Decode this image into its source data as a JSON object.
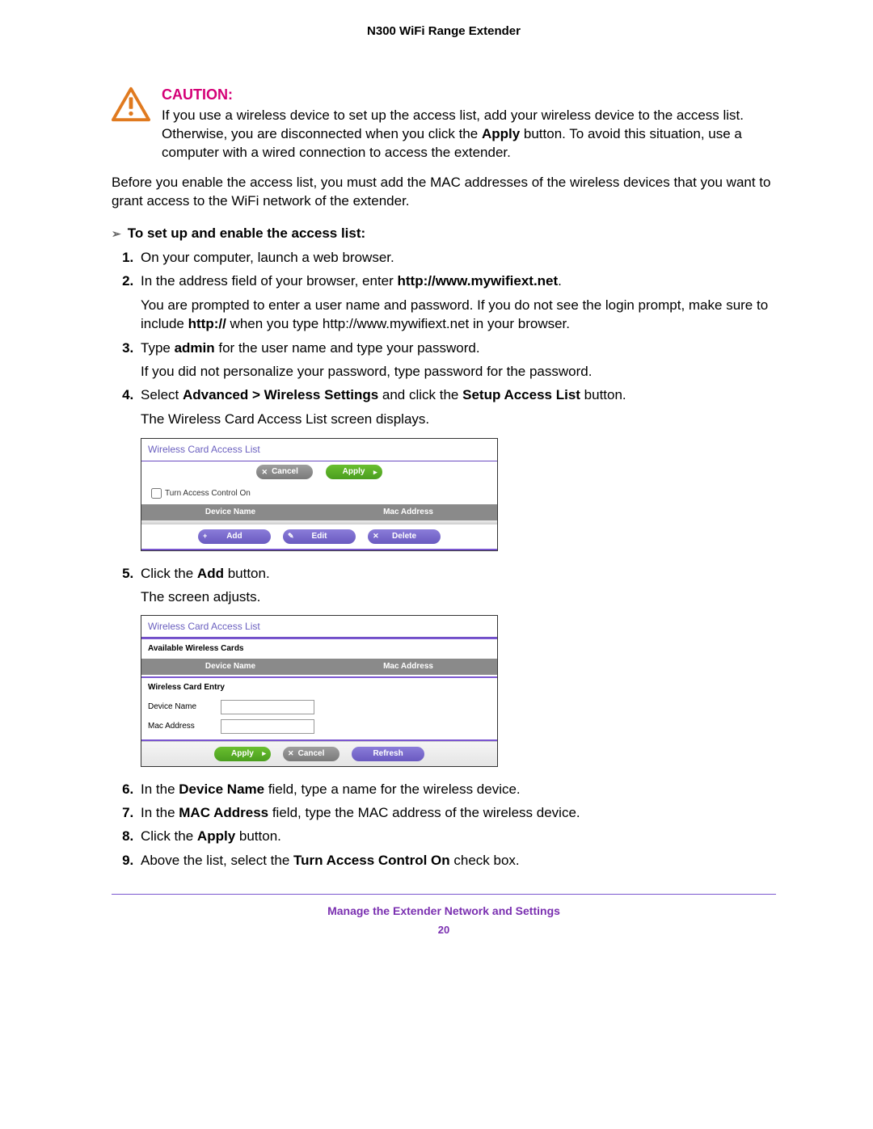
{
  "header": {
    "title": "N300 WiFi Range Extender"
  },
  "caution": {
    "label": "CAUTION:",
    "text_before_bold": "If you use a wireless device to set up the access list, add your wireless device to the access list. Otherwise, you are disconnected when you click the ",
    "bold_word": "Apply",
    "text_after_bold": " button. To avoid this situation, use a computer with a wired connection to access the extender."
  },
  "prelist": "Before you enable the access list, you must add the MAC addresses of the wireless devices that you want to grant access to the WiFi network of the extender.",
  "proc_heading": "To set up and enable the access list:",
  "steps": {
    "s1": "On your computer, launch a web browser.",
    "s2_a": "In the address field of your browser, enter ",
    "s2_b": "http://www.mywifiext.net",
    "s2_c": ".",
    "s2_sub_a": "You are prompted to enter a user name and password. If you do not see the login prompt, make sure to include ",
    "s2_sub_b": "http://",
    "s2_sub_c": " when you type http://www.mywifiext.net in your browser.",
    "s3_a": "Type ",
    "s3_b": "admin",
    "s3_c": " for the user name and type your password.",
    "s3_sub": "If you did not personalize your password, type password for the password.",
    "s4_a": "Select ",
    "s4_b": "Advanced > Wireless Settings",
    "s4_c": " and click the ",
    "s4_d": "Setup Access List",
    "s4_e": " button.",
    "s4_sub": "The Wireless Card Access List screen displays.",
    "s5_a": "Click the ",
    "s5_b": "Add",
    "s5_c": " button.",
    "s5_sub": "The screen adjusts.",
    "s6_a": "In the ",
    "s6_b": "Device Name",
    "s6_c": " field, type a name for the wireless device.",
    "s7_a": "In the ",
    "s7_b": "MAC Address",
    "s7_c": " field, type the MAC address of the wireless device.",
    "s8_a": "Click the ",
    "s8_b": "Apply",
    "s8_c": " button.",
    "s9_a": "Above the list, select the ",
    "s9_b": "Turn Access Control On",
    "s9_c": " check box."
  },
  "shot1": {
    "title": "Wireless Card Access List",
    "cancel": "Cancel",
    "apply": "Apply",
    "checkbox": "Turn Access Control On",
    "col1": "Device Name",
    "col2": "Mac Address",
    "add": "Add",
    "edit": "Edit",
    "delete": "Delete"
  },
  "shot2": {
    "title": "Wireless Card Access List",
    "section1": "Available Wireless Cards",
    "col1": "Device Name",
    "col2": "Mac Address",
    "section2": "Wireless Card Entry",
    "label1": "Device Name",
    "label2": "Mac Address",
    "apply": "Apply",
    "cancel": "Cancel",
    "refresh": "Refresh"
  },
  "footer": {
    "text": "Manage the Extender Network and Settings",
    "page": "20"
  }
}
